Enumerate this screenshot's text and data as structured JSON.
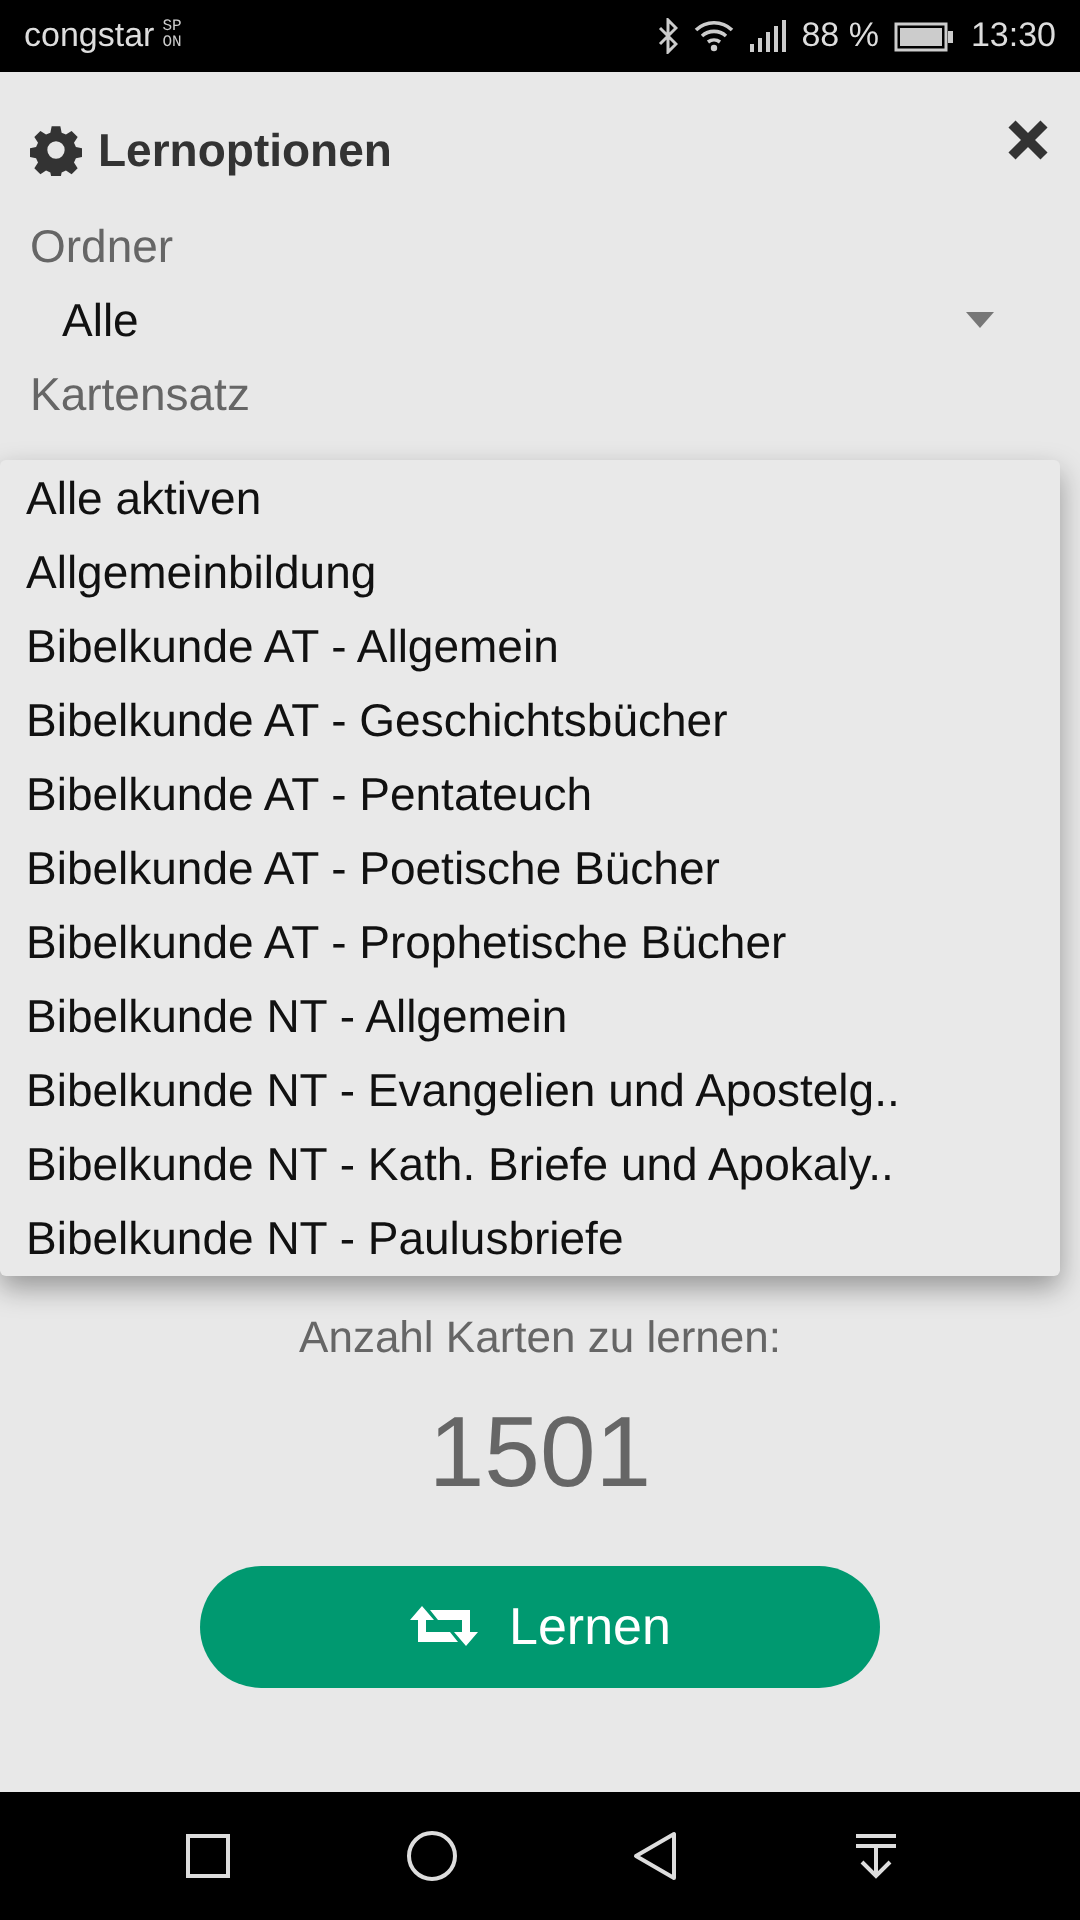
{
  "status_bar": {
    "carrier": "congstar",
    "carrier_badge_top": "SP",
    "carrier_badge_bottom": "ON",
    "battery": "88 %",
    "time": "13:30"
  },
  "dialog": {
    "title": "Lernoptionen",
    "fields": [
      {
        "label": "Ordner",
        "value": "Alle"
      },
      {
        "label": "Kartensatz"
      }
    ],
    "dropdown": [
      {
        "label": "Alle aktiven"
      },
      {
        "label": "Allgemeinbildung"
      },
      {
        "label": "Bibelkunde AT - Allgemein"
      },
      {
        "label": "Bibelkunde AT - Geschichtsbücher"
      },
      {
        "label": "Bibelkunde AT - Pentateuch"
      },
      {
        "label": "Bibelkunde AT - Poetische Bücher"
      },
      {
        "label": "Bibelkunde AT - Prophetische Bücher"
      },
      {
        "label": "Bibelkunde NT - Allgemein"
      },
      {
        "label": "Bibelkunde NT - Evangelien und Apostelg.."
      },
      {
        "label": "Bibelkunde NT - Kath. Briefe und Apokaly.."
      },
      {
        "label": "Bibelkunde NT - Paulusbriefe"
      }
    ],
    "count_label": "Anzahl Karten zu lernen:",
    "count": "1501",
    "button": "Lernen"
  }
}
